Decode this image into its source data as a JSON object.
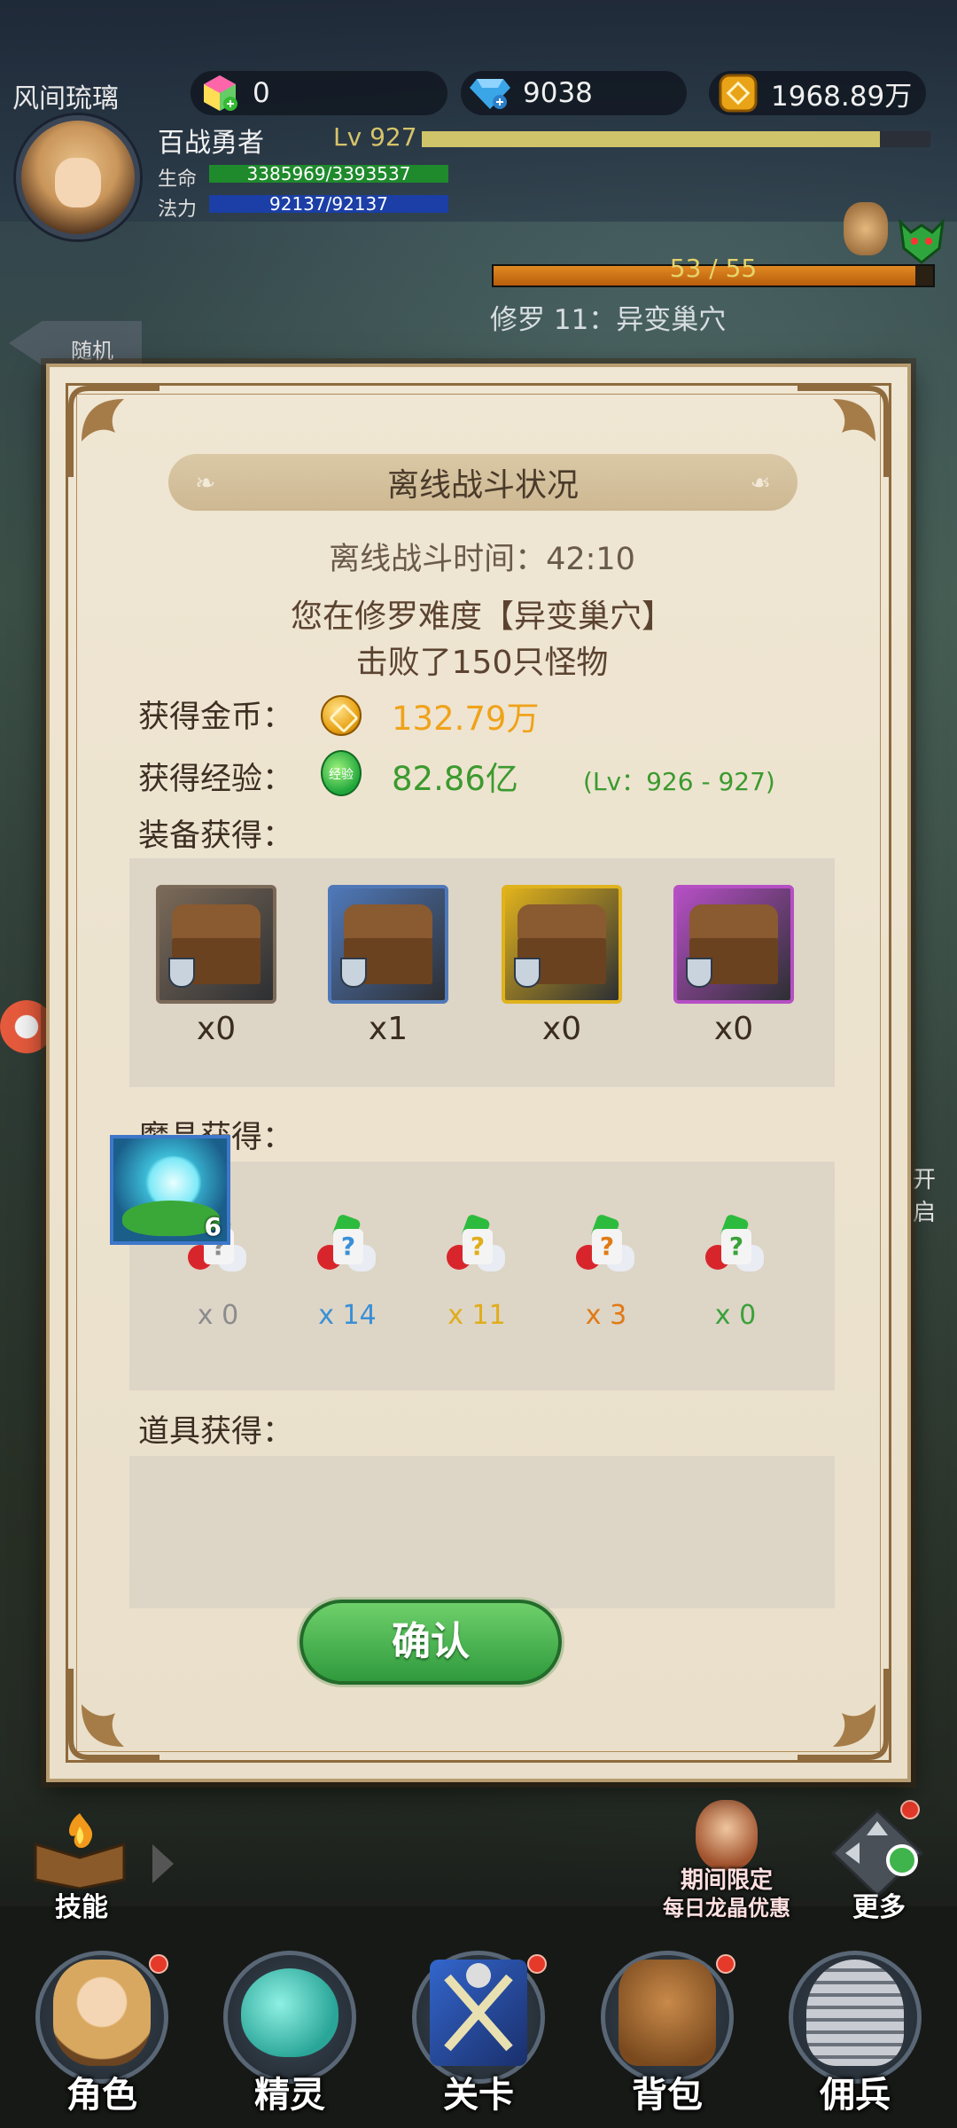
{
  "hud": {
    "player_name": "风间琉璃",
    "crystal_value": "0",
    "diamond_value": "9038",
    "gold_value": "1968.89万",
    "title": "百战勇者",
    "level": "Lv 927",
    "level_progress": 0.9,
    "hp_label": "生命",
    "hp_value": "3385969/3393537",
    "mp_label": "法力",
    "mp_value": "92137/92137",
    "boss_progress": "53 / 55",
    "boss_fraction": 0.96,
    "stage_name": "修罗 11：异变巢穴",
    "back_label": "随机"
  },
  "modal": {
    "title": "离线战斗状况",
    "time_line": "离线战斗时间：42:10",
    "desc_line1": "您在修罗难度【异变巢穴】",
    "desc_line2": "击败了150只怪物",
    "gold_label": "获得金币：",
    "gold_value": "132.79万",
    "exp_label": "获得经验：",
    "exp_badge": "经验",
    "exp_value": "82.86亿",
    "exp_level_range": "(Lv：926 - 927)",
    "equip_label": "装备获得：",
    "chests": [
      {
        "count": "x0",
        "color": "#7b6a58"
      },
      {
        "count": "x1",
        "color": "#4f78b8"
      },
      {
        "count": "x0",
        "color": "#e0b21c"
      },
      {
        "count": "x0",
        "color": "#b54fc4"
      }
    ],
    "crystal_label": "魔晶获得：",
    "crystals": [
      {
        "count": "x 0",
        "color": "#8c8c8c"
      },
      {
        "count": "x 14",
        "color": "#3a8fd6"
      },
      {
        "count": "x 11",
        "color": "#e0ad1a"
      },
      {
        "count": "x 3",
        "color": "#e07a15"
      },
      {
        "count": "x 0",
        "color": "#3aa13a"
      }
    ],
    "item_label": "道具获得：",
    "item_count": "6",
    "confirm": "确认"
  },
  "side": {
    "right_label": "开启"
  },
  "quick": {
    "skill": "技能",
    "limited_line1": "期间限定",
    "limited_line2": "每日龙晶优惠",
    "more": "更多"
  },
  "nav": {
    "role": "角色",
    "spirit": "精灵",
    "stage": "关卡",
    "bag": "背包",
    "merc": "佣兵"
  }
}
